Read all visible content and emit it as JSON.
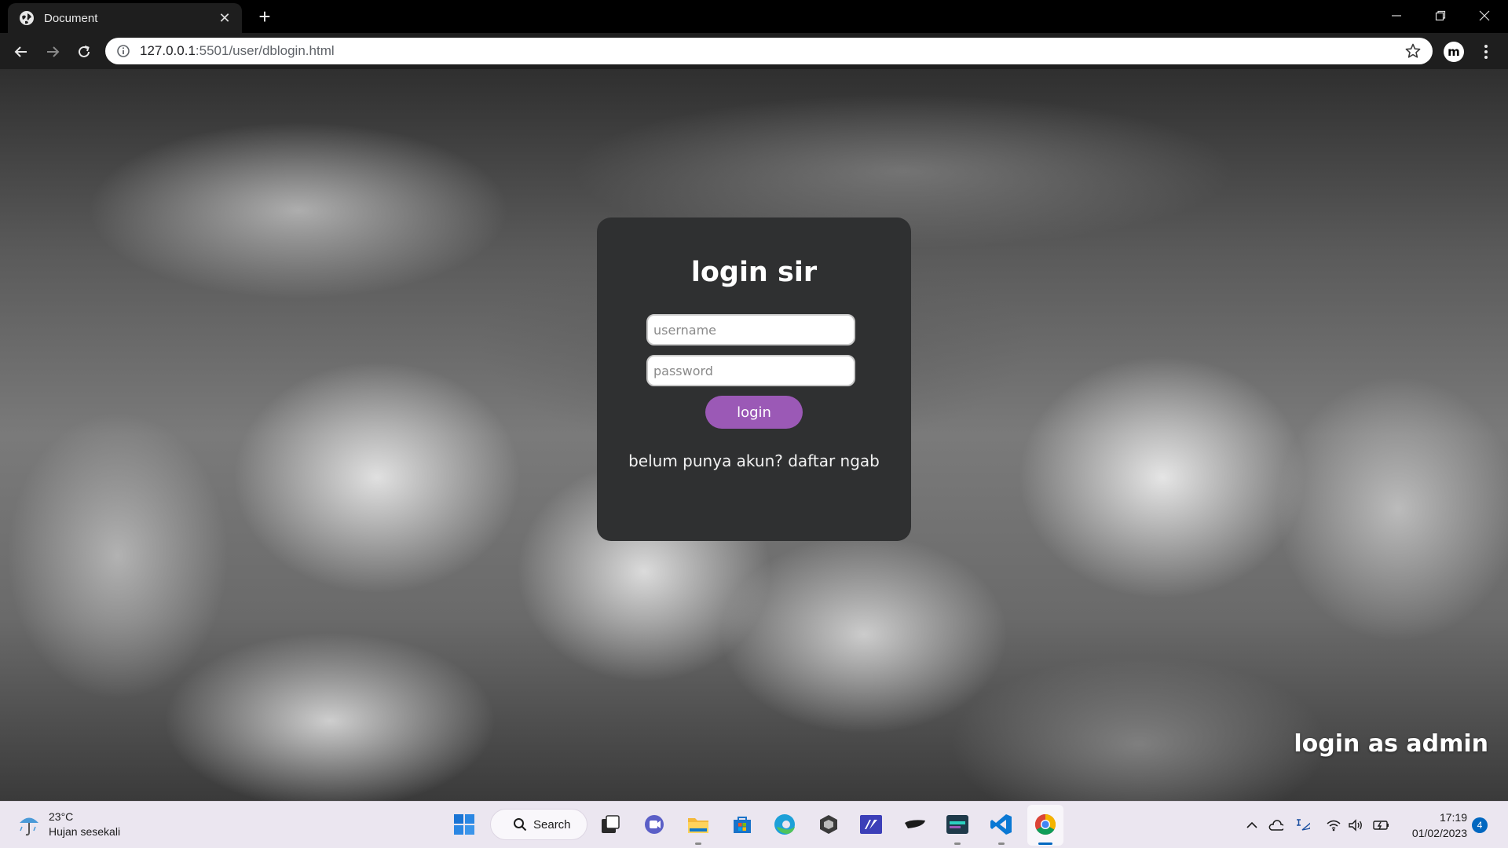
{
  "browser": {
    "tab_title": "Document",
    "url_host": "127.0.0.1",
    "url_rest": ":5501/user/dblogin.html",
    "extension_label": "m"
  },
  "login": {
    "title": "login sir",
    "username_placeholder": "username",
    "password_placeholder": "password",
    "login_button": "login",
    "register_prompt": "belum punya akun? daftar ngab"
  },
  "admin_link": "login as admin",
  "taskbar": {
    "weather_temp": "23°C",
    "weather_desc": "Hujan sesekali",
    "search_label": "Search",
    "time": "17:19",
    "date": "01/02/2023",
    "notification_count": "4",
    "apps": [
      "start-icon",
      "search-icon",
      "task-view-icon",
      "teams-chat-icon",
      "file-explorer-icon",
      "microsoft-store-icon",
      "edge-icon",
      "unity-icon",
      "vs-icon",
      "tool-icon",
      "media-icon",
      "vscode-icon",
      "chrome-icon"
    ]
  },
  "colors": {
    "card_bg": "#2f3031",
    "login_button": "#9b59b6",
    "taskbar_bg": "#ebe6f0",
    "accent": "#0067c0"
  }
}
